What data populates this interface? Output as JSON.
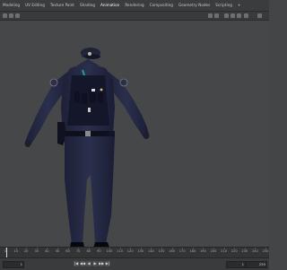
{
  "menu": {
    "tabs": [
      "Modeling",
      "UV Editing",
      "Texture Paint",
      "Shading",
      "Animation",
      "Rendering",
      "Compositing",
      "Geometry Nodes",
      "Scripting",
      "+"
    ],
    "active_tab": 4
  },
  "viewport": {
    "label": "",
    "background": "#464748",
    "uniform_color": "#1b1f38"
  },
  "timeline": {
    "ticks": [
      "0",
      "10",
      "20",
      "30",
      "40",
      "50",
      "60",
      "70",
      "80",
      "90",
      "100",
      "110",
      "120",
      "130",
      "140",
      "150",
      "160",
      "170",
      "180",
      "190",
      "200",
      "210",
      "220",
      "230",
      "240",
      "250"
    ],
    "current_frame_display": "1",
    "start_frame": "1",
    "end_frame": "250"
  },
  "playback": {
    "buttons": [
      "|◀",
      "◀◀",
      "◀",
      "▶",
      "▶▶",
      "▶|"
    ]
  }
}
